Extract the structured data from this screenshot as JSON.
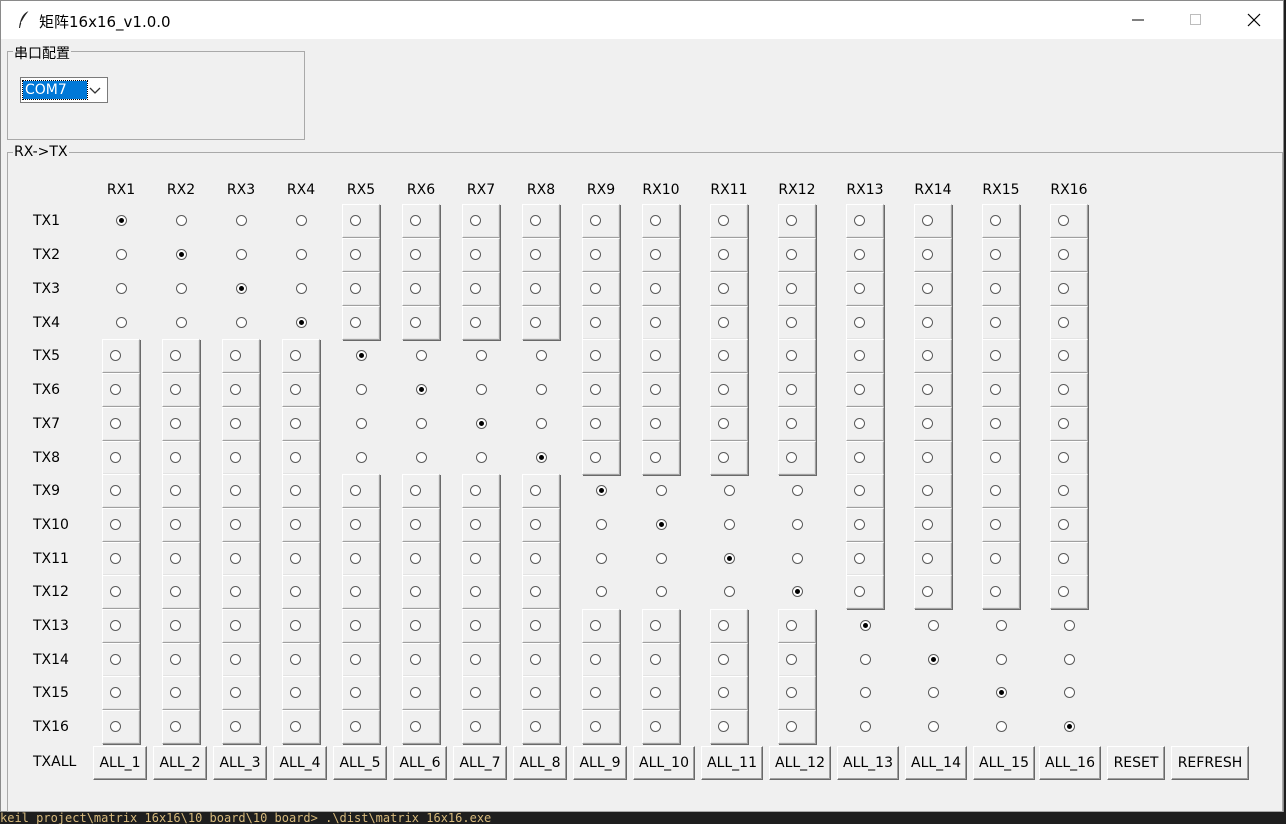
{
  "window": {
    "title": "矩阵16x16_v1.0.0",
    "icon": "feather-icon"
  },
  "serial": {
    "group_label": "串口配置",
    "port_value": "COM7"
  },
  "matrix": {
    "group_label": "RX->TX",
    "rx_labels": [
      "RX1",
      "RX2",
      "RX3",
      "RX4",
      "RX5",
      "RX6",
      "RX7",
      "RX8",
      "RX9",
      "RX10",
      "RX11",
      "RX12",
      "RX13",
      "RX14",
      "RX15",
      "RX16"
    ],
    "tx_labels": [
      "TX1",
      "TX2",
      "TX3",
      "TX4",
      "TX5",
      "TX6",
      "TX7",
      "TX8",
      "TX9",
      "TX10",
      "TX11",
      "TX12",
      "TX13",
      "TX14",
      "TX15",
      "TX16"
    ],
    "txall_label": "TXALL",
    "selected_rx_for_tx": [
      1,
      2,
      3,
      4,
      5,
      6,
      7,
      8,
      9,
      10,
      11,
      12,
      13,
      14,
      15,
      16
    ]
  },
  "buttons": {
    "all_labels": [
      "ALL_1",
      "ALL_2",
      "ALL_3",
      "ALL_4",
      "ALL_5",
      "ALL_6",
      "ALL_7",
      "ALL_8",
      "ALL_9",
      "ALL_10",
      "ALL_11",
      "ALL_12",
      "ALL_13",
      "ALL_14",
      "ALL_15",
      "ALL_16"
    ],
    "reset": "RESET",
    "refresh": "REFRESH"
  },
  "terminal": {
    "line": "keil_project\\matrix_16x16\\10_board\\10_board> .\\dist\\matrix_16x16.exe"
  }
}
